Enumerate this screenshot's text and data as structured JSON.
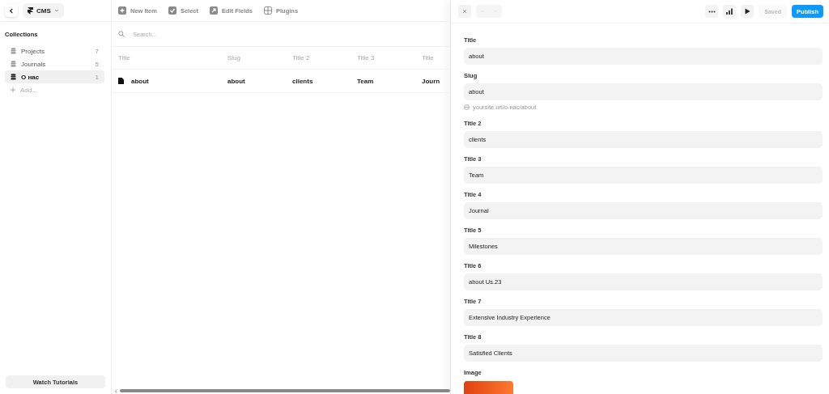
{
  "app_menu": {
    "label": "CMS"
  },
  "toolbar": [
    {
      "kind": "plus",
      "label": "New Item"
    },
    {
      "kind": "check",
      "label": "Select"
    },
    {
      "kind": "edit",
      "label": "Edit Fields"
    },
    {
      "kind": "grid",
      "label": "Plugins"
    }
  ],
  "sidebar": {
    "title": "Collections",
    "items": [
      {
        "name": "Projects",
        "count": "7",
        "selected": false
      },
      {
        "name": "Journals",
        "count": "5",
        "selected": false
      },
      {
        "name": "О нас",
        "count": "1",
        "selected": true
      }
    ],
    "add_label": "Add...",
    "footer_button": "Watch Tutorials"
  },
  "search": {
    "placeholder": "Search..."
  },
  "table": {
    "columns": [
      "Title",
      "Slug",
      "Title 2",
      "Title 3",
      "Title"
    ],
    "rows": [
      {
        "cells": [
          "about",
          "about",
          "clients",
          "Team",
          "Journ"
        ]
      }
    ]
  },
  "panel": {
    "status": "Saved",
    "publish": "Publish",
    "fields": [
      {
        "kind": "text",
        "label": "Title",
        "value": "about"
      },
      {
        "kind": "slug",
        "label": "Slug",
        "value": "about",
        "hint": "yoursite.url/о-нас/about"
      },
      {
        "kind": "text",
        "label": "Title 2",
        "value": "clients"
      },
      {
        "kind": "text",
        "label": "Title 3",
        "value": "Team"
      },
      {
        "kind": "text",
        "label": "Title 4",
        "value": "Journal"
      },
      {
        "kind": "text",
        "label": "Title 5",
        "value": "Milestones"
      },
      {
        "kind": "text",
        "label": "Title 6",
        "value": "about Us.23"
      },
      {
        "kind": "text",
        "label": "Title 7",
        "value": "Extensive Industry Experience"
      },
      {
        "kind": "text",
        "label": "Title 8",
        "value": "Satisfied Clients"
      },
      {
        "kind": "image",
        "label": "Image"
      }
    ]
  }
}
